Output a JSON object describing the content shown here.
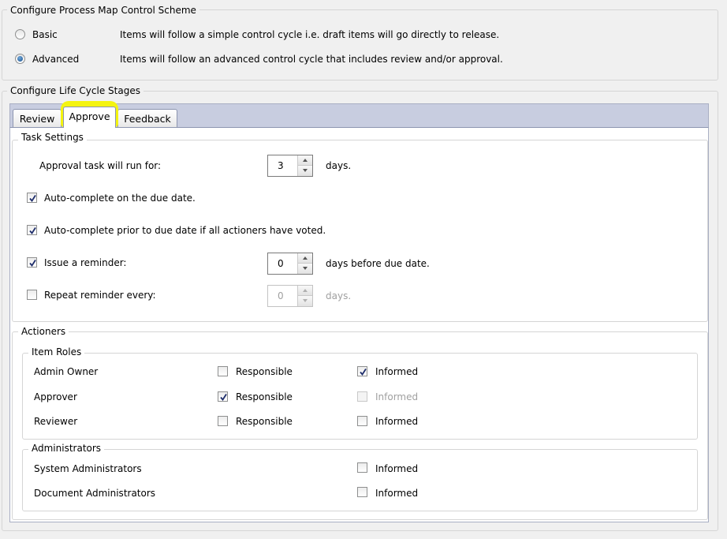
{
  "scheme": {
    "title": "Configure Process Map Control Scheme",
    "options": [
      {
        "label": "Basic",
        "description": "Items will follow a simple control cycle i.e. draft items will go directly to release.",
        "selected": false
      },
      {
        "label": "Advanced",
        "description": "Items will follow an advanced control cycle that includes review and/or approval.",
        "selected": true
      }
    ]
  },
  "lifecycle": {
    "title": "Configure Life Cycle Stages",
    "tabs": [
      {
        "label": "Review",
        "active": false
      },
      {
        "label": "Approve",
        "active": true,
        "highlighted": true
      },
      {
        "label": "Feedback",
        "active": false
      }
    ]
  },
  "task_settings": {
    "title": "Task Settings",
    "run_for_label": "Approval task will run for:",
    "run_for_value": "3",
    "run_for_unit": "days.",
    "auto_complete_due": {
      "label": "Auto-complete on the due date.",
      "checked": true
    },
    "auto_complete_voted": {
      "label": "Auto-complete prior to due date if all actioners have voted.",
      "checked": true
    },
    "reminder": {
      "label": "Issue a reminder:",
      "checked": true,
      "value": "0",
      "unit": "days before due date."
    },
    "repeat_reminder": {
      "label": "Repeat reminder every:",
      "checked": false,
      "value": "0",
      "unit": "days.",
      "disabled": true
    }
  },
  "actioners": {
    "title": "Actioners",
    "item_roles": {
      "title": "Item Roles",
      "rows": [
        {
          "name": "Admin Owner",
          "responsible_label": "Responsible",
          "responsible": false,
          "informed_label": "Informed",
          "informed": true,
          "informed_disabled": false
        },
        {
          "name": "Approver",
          "responsible_label": "Responsible",
          "responsible": true,
          "informed_label": "Informed",
          "informed": false,
          "informed_disabled": true
        },
        {
          "name": "Reviewer",
          "responsible_label": "Responsible",
          "responsible": false,
          "informed_label": "Informed",
          "informed": false,
          "informed_disabled": false
        }
      ]
    },
    "administrators": {
      "title": "Administrators",
      "rows": [
        {
          "name": "System Administrators",
          "informed_label": "Informed",
          "informed": false
        },
        {
          "name": "Document Administrators",
          "informed_label": "Informed",
          "informed": false
        }
      ]
    }
  }
}
